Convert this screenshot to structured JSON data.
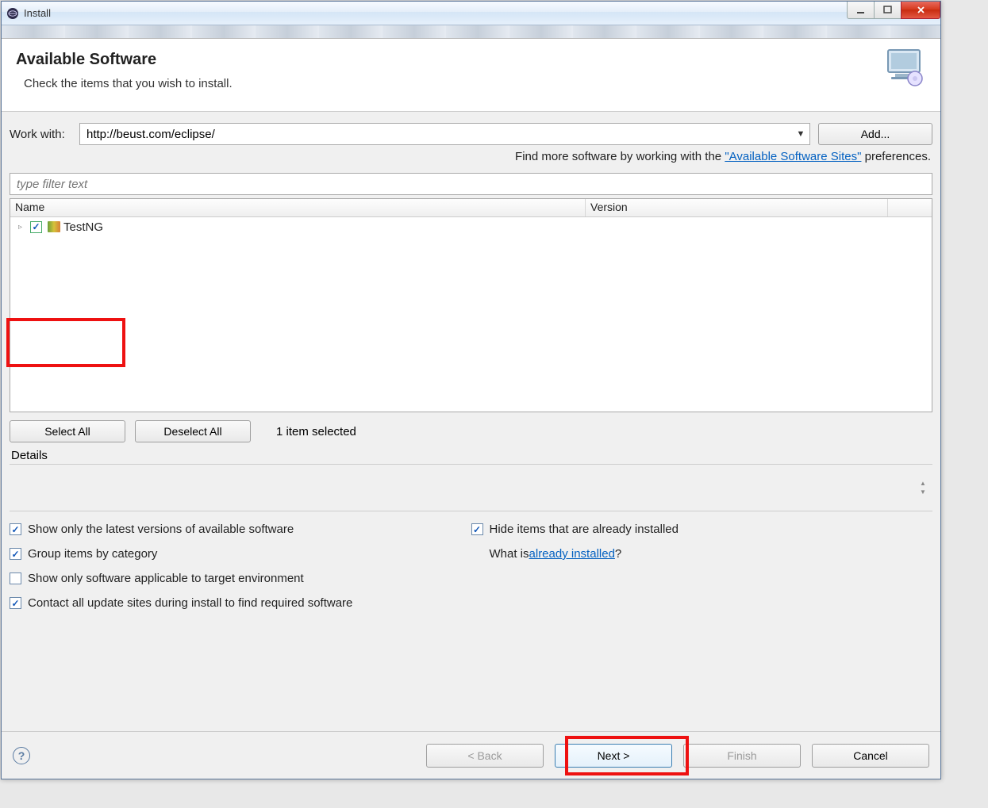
{
  "window": {
    "title": "Install"
  },
  "header": {
    "title": "Available Software",
    "subtitle": "Check the items that you wish to install."
  },
  "workWith": {
    "label": "Work with:",
    "value": "http://beust.com/eclipse/",
    "addButton": "Add..."
  },
  "findMore": {
    "prefix": "Find more software by working with the ",
    "link": "\"Available Software Sites\"",
    "suffix": " preferences."
  },
  "filter": {
    "placeholder": "type filter text"
  },
  "tree": {
    "columns": {
      "name": "Name",
      "version": "Version"
    },
    "items": [
      {
        "checked": true,
        "label": "TestNG"
      }
    ]
  },
  "selection": {
    "selectAll": "Select All",
    "deselectAll": "Deselect All",
    "countText": "1 item selected"
  },
  "details": {
    "label": "Details"
  },
  "options": {
    "showLatest": {
      "checked": true,
      "label": "Show only the latest versions of available software"
    },
    "groupCategory": {
      "checked": true,
      "label": "Group items by category"
    },
    "applicableTarget": {
      "checked": false,
      "label": "Show only software applicable to target environment"
    },
    "contactAll": {
      "checked": true,
      "label": "Contact all update sites during install to find required software"
    },
    "hideInstalled": {
      "checked": true,
      "label": "Hide items that are already installed"
    },
    "whatIs": {
      "prefix": "What is ",
      "link": "already installed",
      "suffix": "?"
    }
  },
  "footer": {
    "back": "< Back",
    "next": "Next >",
    "finish": "Finish",
    "cancel": "Cancel"
  }
}
